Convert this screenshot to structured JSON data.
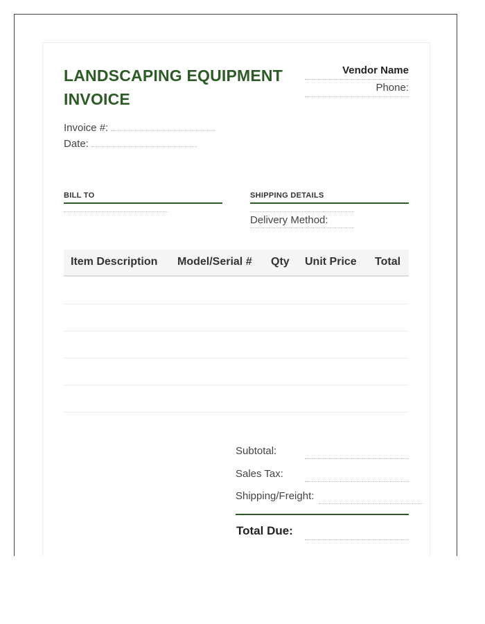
{
  "document": {
    "title": "LANDSCAPING EQUIPMENT INVOICE",
    "vendor_name": "Vendor Name",
    "phone_label": "Phone:",
    "invoice_label": "Invoice #:",
    "date_label": "Date:"
  },
  "sections": {
    "bill_to": "BILL TO",
    "shipping": "SHIPPING DETAILS",
    "delivery_label": "Delivery Method:"
  },
  "table": {
    "columns": [
      "Item Description",
      "Model/Serial #",
      "Qty",
      "Unit Price",
      "Total"
    ],
    "rows": [
      [
        "",
        "",
        "",
        "",
        ""
      ],
      [
        "",
        "",
        "",
        "",
        ""
      ],
      [
        "",
        "",
        "",
        "",
        ""
      ],
      [
        "",
        "",
        "",
        "",
        ""
      ],
      [
        "",
        "",
        "",
        "",
        ""
      ]
    ]
  },
  "totals": {
    "subtotal": "Subtotal:",
    "sales_tax": "Sales Tax:",
    "shipping": "Shipping/Freight:",
    "total_due": "Total Due:"
  },
  "colors": {
    "accent": "#2d5a27",
    "text": "#333333"
  }
}
